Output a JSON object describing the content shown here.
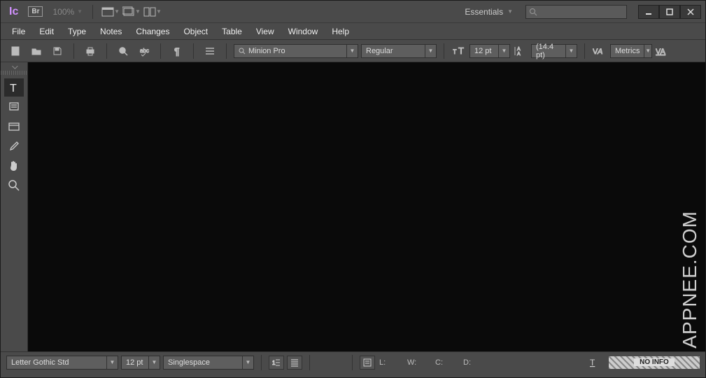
{
  "titlebar": {
    "app": "Ic",
    "bridge": "Br",
    "zoom": "100%",
    "workspace": "Essentials"
  },
  "menu": [
    "File",
    "Edit",
    "Type",
    "Notes",
    "Changes",
    "Object",
    "Table",
    "View",
    "Window",
    "Help"
  ],
  "options": {
    "font": "Minion Pro",
    "style": "Regular",
    "size": "12 pt",
    "leading": "(14.4 pt)",
    "kerning": "Metrics"
  },
  "status": {
    "font": "Letter Gothic Std",
    "size": "12 pt",
    "spacing": "Singlespace",
    "L": "L:",
    "W": "W:",
    "C": "C:",
    "D": "D:",
    "noinfo": "NO INFO"
  },
  "watermark": "APPNEE.COM"
}
